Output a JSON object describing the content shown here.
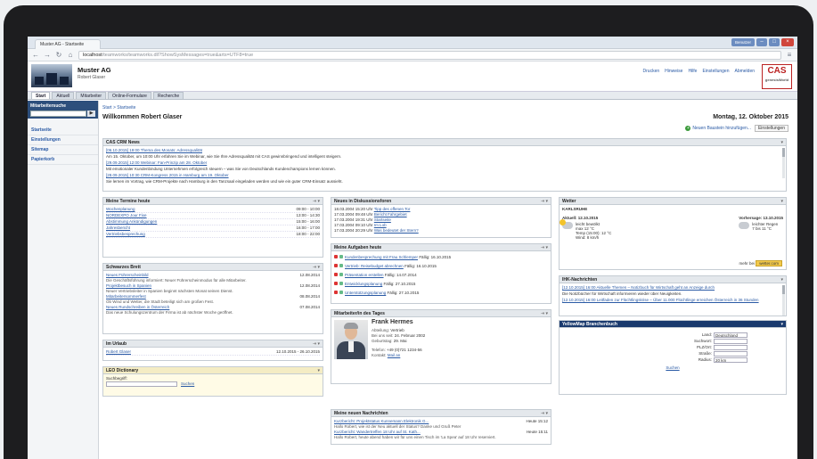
{
  "browser": {
    "tab_title": "Muster AG - Startseite",
    "url_host": "localhost",
    "url_path": "/teamworks/teamworks.dll?ShowSysMessages=true&arts=UTF8=true",
    "window_user": "Benutzer"
  },
  "app": {
    "company": "Muster AG",
    "user": "Robert Glaser",
    "top_links": [
      "Drucken",
      "Hinweise",
      "Hilfe",
      "Einstellungen",
      "Abmelden"
    ],
    "logo_text": "CAS",
    "logo_sub": "genesisWorld"
  },
  "menu": [
    "Start",
    "Aktuell",
    "Mitarbeiter",
    "Online-Formulare",
    "Recherche"
  ],
  "sidebar": {
    "search_label": "Mitarbeitersuche",
    "search_button": "▶",
    "items": [
      "Startseite",
      "Einstellungen",
      "Sitemap",
      "Papierkorb"
    ]
  },
  "page": {
    "breadcrumb": "Start > Startseite",
    "welcome": "Willkommen Robert Glaser",
    "date": "Montag, 12. Oktober 2015",
    "new_item": "Neuen Baustein hinzufügen...",
    "settings": "Einstellungen"
  },
  "news": {
    "title": "CAS CRM News",
    "items": [
      "[06.10.2015] 19:00 Thema des Monats: Adressqualität",
      "Am 15. Oktober, um 10:00 Uhr erfahren Sie im Webinar, wie Sie Ihre Adressqualität mit CAS gewinnbringend und intelligent steigern.",
      "[29.09.2015] 12:00 Webinar: Fan-Prinzip am 28. Oktober",
      "Mit emotionaler Kundenbindung Unternehmen erfolgreich steuern – was Sie von Deutschlands Kundenchampions lernen können.",
      "[28.09.2015] 10:30 CRM-Kongress 2015 in Hamburg am 19. Oktober",
      "Sie lernen im Vortrag, wie CRM-Projekte nach Hamburg in den Tanzsaal eingeladen werden und wie ein guter CRM-Einsatz aussieht."
    ]
  },
  "termine": {
    "title": "Meine Termine heute",
    "rows": [
      {
        "name": "Wochenplanung",
        "time": "09:00 - 10:00"
      },
      {
        "name": "NORDEXPO Jour Fixe",
        "time": "13:00 - 14:30"
      },
      {
        "name": "Abstimmung Ankündigungen",
        "time": "15:00 - 16:00"
      },
      {
        "name": "Jahresbericht",
        "time": "16:00 - 17:00"
      },
      {
        "name": "Vertriebsbesprechung",
        "time": "18:00 - 22:00"
      }
    ]
  },
  "brett": {
    "title": "Schwarzes Brett",
    "items": [
      {
        "head": "Neues Führerscheinbild",
        "date": "12.08.2014",
        "text": "Die Geschäftsführung informiert: Neuer Führerscheinmodus für alle Mitarbeiter."
      },
      {
        "head": "Projektbesuch in Spanien",
        "date": "12.08.2014",
        "text": "Neuer Vertriebsleiter in Spanien beginnt nächsten Monat seinen Dienst."
      },
      {
        "head": "Mitarbeitersommerfest",
        "date": "08.08.2014",
        "text": "Ob Wind und Wetter, die Stadt beteiligt sich am großen Fest."
      },
      {
        "head": "Neues Rundschreiben in Österreich",
        "date": "07.08.2014",
        "text": "Das neue Schulungszentrum der Firma ist ab nächster Woche geöffnet."
      }
    ]
  },
  "urlaub": {
    "title": "Im Urlaub",
    "rows": [
      {
        "name": "Robert Glaser",
        "range": "12.10.2015 - 26.10.2015"
      }
    ]
  },
  "leo": {
    "title": "LEO Dictionary",
    "label": "Suchbegriff:",
    "button": "Suchen"
  },
  "diskussion": {
    "title": "Neues in Diskussionsforen",
    "rows": [
      {
        "date": "18.03.2004 15:20 Uhr",
        "text": "Tipp des offenen Tor"
      },
      {
        "date": "17.03.2004 09:48 Uhr",
        "text": "Bericht Fahrgebiet"
      },
      {
        "date": "17.03.2004 19:31 Uhr",
        "text": "Startseite"
      },
      {
        "date": "17.03.2004 09:10 Uhr",
        "text": "Im Lob"
      },
      {
        "date": "17.03.2004 20:29 Uhr",
        "text": "Was bedeutet der Stern?"
      }
    ]
  },
  "aufgaben": {
    "title": "Meine Aufgaben heute",
    "rows": [
      {
        "text": "Kundenbesprechung mit Frau Schlemper",
        "due": "Fällig: 16.10.2015"
      },
      {
        "text": "Vertrieb: Reisebudget abrechnen",
        "due": "Fällig: 16.10.2015"
      },
      {
        "text": "Präsentation erstellen",
        "due": "Fällig: 14.07.2014"
      },
      {
        "text": "Entwicklungsplanung",
        "due": "Fällig: 27.10.2015"
      },
      {
        "text": "Unterstützungsplanung",
        "due": "Fällig: 27.10.2015"
      }
    ]
  },
  "mitarbeiter": {
    "title": "Mitarbeiter/in des Tages",
    "name": "Frank Hermes",
    "fields": [
      {
        "k": "Abteilung:",
        "v": "Vertrieb"
      },
      {
        "k": "Bei uns seit:",
        "v": "24. Februar 2002"
      },
      {
        "k": "Geburtstag:",
        "v": "29. Mai"
      },
      {
        "k": "Telefon:",
        "v": "+49 (0)721 1234-56"
      },
      {
        "k": "Kontakt:",
        "v": "Mail an"
      }
    ]
  },
  "nachrichten": {
    "title": "Meine neuen Nachrichten",
    "rows": [
      {
        "subject": "Kurzbericht: Projektstatus Kunnemann Elektronik G...",
        "from": "Heute 15:12",
        "text": "Hallo Robert, wie ist der Neu aktuell der Status? Danke und Gruß Peter"
      },
      {
        "subject": "Kurzbericht: Wandertreffen 18 Uhr auf St. Kath...",
        "from": "Heute 15:11",
        "text": "Hallo Robert, heute abend haben wir für uns einen Tisch im 'La Spea' auf 18 Uhr reserviert."
      }
    ]
  },
  "wetter": {
    "title": "Wetter",
    "place": "KARLSRUHE",
    "today": {
      "label": "Aktuell: 12.10.2015",
      "desc": "leicht bewölkt",
      "temp": "max 12 °C",
      "wind": "Temp (15:00): 12 °C",
      "rain": "Wind: 8 km/h"
    },
    "tomorrow": {
      "label": "Vorhersage: 13.10.2015",
      "desc": "leichter Regen",
      "temp": "7 bis 11 °C"
    },
    "more": "mehr bei",
    "source": "wetter.com"
  },
  "ihk": {
    "title": "IHK-Nachrichten",
    "items": [
      "[12.10.2015] 16:00 Aktuelle Themen – Notizbuch für Wirtschaft geht an Anzeige durch",
      "Die Notizbücher für Wirtschaft informieren wieder über Neuigkeiten.",
      "[12.10.2015] 16:00 Leitfaden zur Flüchtlingskrise – Über 11.000 Flüchtlinge erreichen Österreich in 36 Stunden"
    ]
  },
  "yellow": {
    "title": "YellowMap Branchenbuch",
    "fields": [
      {
        "k": "Land:",
        "v": "Deutschland"
      },
      {
        "k": "Suchwort:",
        "v": ""
      },
      {
        "k": "PLZ/Ort:",
        "v": ""
      },
      {
        "k": "Straße:",
        "v": ""
      },
      {
        "k": "Radius:",
        "v": "20 km"
      }
    ],
    "button": "Suchen"
  },
  "colors": {
    "accent": "#2a5aa5",
    "sidebar": "#2d4f7c",
    "yellowmap": "#1a3a6e",
    "task": "#d33333"
  }
}
